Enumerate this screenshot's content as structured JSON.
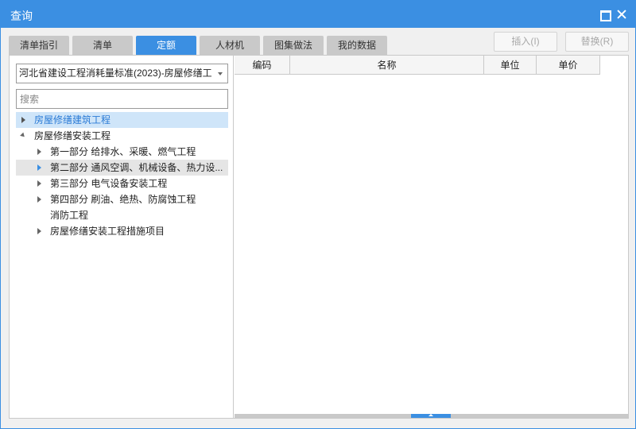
{
  "window": {
    "title": "查询"
  },
  "tabs": [
    {
      "label": "清单指引",
      "active": false
    },
    {
      "label": "清单",
      "active": false
    },
    {
      "label": "定额",
      "active": true
    },
    {
      "label": "人材机",
      "active": false
    },
    {
      "label": "图集做法",
      "active": false
    },
    {
      "label": "我的数据",
      "active": false
    }
  ],
  "actions": {
    "insert_label": "插入(I)",
    "replace_label": "替换(R)"
  },
  "left": {
    "selected_quota": "河北省建设工程消耗量标准(2023)-房屋修缮工",
    "search_placeholder": "搜索"
  },
  "tree": [
    {
      "label": "房屋修缮建筑工程",
      "state": "collapsed",
      "level": 0,
      "selected": true
    },
    {
      "label": "房屋修缮安装工程",
      "state": "expanded",
      "level": 0
    },
    {
      "label": "第一部分 给排水、采暖、燃气工程",
      "state": "collapsed",
      "level": 1
    },
    {
      "label": "第二部分 通风空调、机械设备、热力设...",
      "state": "collapsed",
      "level": 1,
      "hovered": true
    },
    {
      "label": "第三部分 电气设备安装工程",
      "state": "collapsed",
      "level": 1
    },
    {
      "label": "第四部分 刷油、绝热、防腐蚀工程",
      "state": "collapsed",
      "level": 1
    },
    {
      "label": "消防工程",
      "state": "none",
      "level": 1
    },
    {
      "label": "房屋修缮安装工程措施项目",
      "state": "collapsed",
      "level": 1
    }
  ],
  "grid": {
    "columns": [
      "编码",
      "名称",
      "单位",
      "单价"
    ]
  },
  "colors": {
    "accent": "#3b8fe2",
    "selected_bg": "#cfe5f9",
    "tab_inactive": "#c9c9c9"
  }
}
